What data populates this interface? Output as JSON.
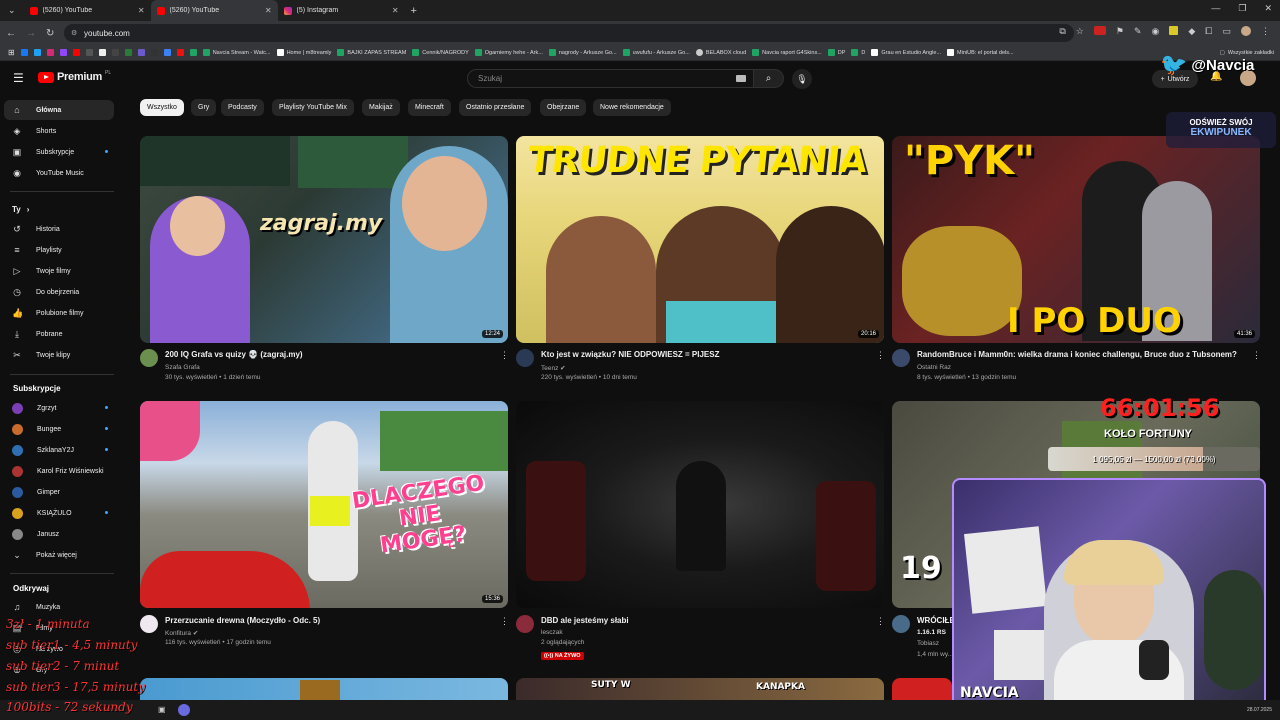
{
  "browser": {
    "tabs": [
      {
        "title": "(5260) YouTube",
        "active": false
      },
      {
        "title": "(5260) YouTube",
        "active": true
      },
      {
        "title": "(5) Instagram",
        "active": false
      }
    ],
    "url": "youtube.com",
    "bookmarks": [
      "Navcia Stream - Watc...",
      "Home | m8treamly",
      "BAJKI ZAPAS STREAM",
      "Cennik/NAGRODY",
      "Ogarniemy hehe - Ark...",
      "nagrody - Arkusze Go...",
      "uwufufu - Arkusze Go...",
      "BELABOX cloud",
      "Navcia raport G4Skins...",
      "DP",
      "D",
      "Grau en Estudio Angle...",
      "MiniUB: el portal dels...",
      "Wszystkie zakładki"
    ]
  },
  "header": {
    "logo": "Premium",
    "logo_country": "PL",
    "search_placeholder": "Szukaj",
    "create_label": "Utwórz"
  },
  "sidebar": {
    "main": [
      {
        "label": "Główna",
        "icon": "home-icon",
        "active": true
      },
      {
        "label": "Shorts",
        "icon": "shorts-icon"
      },
      {
        "label": "Subskrypcje",
        "icon": "subscriptions-icon",
        "dot": true
      },
      {
        "label": "YouTube Music",
        "icon": "music-icon"
      }
    ],
    "you_heading": "Ty",
    "you": [
      {
        "label": "Historia",
        "icon": "history-icon"
      },
      {
        "label": "Playlisty",
        "icon": "playlist-icon"
      },
      {
        "label": "Twoje filmy",
        "icon": "video-icon"
      },
      {
        "label": "Do obejrzenia",
        "icon": "clock-icon"
      },
      {
        "label": "Polubione filmy",
        "icon": "like-icon"
      },
      {
        "label": "Pobrane",
        "icon": "download-icon"
      },
      {
        "label": "Twoje klipy",
        "icon": "scissors-icon"
      }
    ],
    "subs_heading": "Subskrypcje",
    "subs": [
      {
        "label": "Zgrzyt",
        "color": "#7b3fb5",
        "dot": true
      },
      {
        "label": "Bungee",
        "color": "#c96b2c",
        "dot": true
      },
      {
        "label": "SzklanaY2J",
        "color": "#2f6fb1",
        "dot": true
      },
      {
        "label": "Karol Friz Wiśniewski",
        "color": "#a33",
        "dot": false
      },
      {
        "label": "Gimper",
        "color": "#2b5a9e",
        "dot": false
      },
      {
        "label": "KSIĄŻULO",
        "color": "#d8a21c",
        "dot": true
      },
      {
        "label": "Janusz",
        "color": "#888",
        "dot": false
      }
    ],
    "more_label": "Pokaż więcej",
    "explore_heading": "Odkrywaj",
    "explore": [
      {
        "label": "Muzyka",
        "icon": "music-note-icon"
      },
      {
        "label": "Filmy",
        "icon": "film-icon"
      },
      {
        "label": "Na żywo",
        "icon": "live-icon"
      },
      {
        "label": "Gry",
        "icon": "gamepad-icon"
      }
    ]
  },
  "chips": [
    "Wszystko",
    "Gry",
    "Podcasty",
    "Playlisty YouTube Mix",
    "Makijaż",
    "Minecraft",
    "Ostatnio przesłane",
    "Obejrzane",
    "Nowe rekomendacje"
  ],
  "videos": [
    {
      "title": "200 IQ Grafa vs quizy 💀 (zagraj.my)",
      "channel": "Szafa Grafa",
      "meta": "30 tys. wyświetleń • 1 dzień temu",
      "duration": "12:24",
      "thumb_text": "zagraj.my"
    },
    {
      "title": "Kto jest w związku? NIE ODPOWIESZ = PIJESZ",
      "channel": "Teenz",
      "meta": "220 tys. wyświetleń • 10 dni temu",
      "duration": "20:16",
      "thumb_text": "TRUDNE PYTANIA",
      "verified": true
    },
    {
      "title": "RandomBruce i Mamm0n: wielka drama i koniec challengu, Bruce duo z Tubsonem?",
      "channel": "Ostatni Raz",
      "meta": "8 tys. wyświetleń • 13 godzin temu",
      "duration": "41:36",
      "thumb_text": "\"PYK\"",
      "thumb_text2": "I PO DUO"
    },
    {
      "title": "Przerzucanie drewna (Moczydło - Odc. 5)",
      "channel": "Konfitura",
      "meta": "116 tys. wyświetleń • 17 godzin temu",
      "duration": "15:36",
      "thumb_text": "DLACZEGO NIE MOGĘ?",
      "verified": true
    },
    {
      "title": "DBD ale jesteśmy słabi",
      "channel": "lesczak",
      "meta": "2 oglądających",
      "live_label": "NA ŻYWO"
    },
    {
      "title": "WRÓCIŁE...",
      "channel": "Tobiasz",
      "meta": "1,4 mln wy...",
      "thumb_text": "1.16.1 RS"
    }
  ],
  "overlays": {
    "handle": "@Navcia",
    "refresh_line1": "ODŚWIEŻ SWÓJ",
    "refresh_line2": "EKWIPUNEK",
    "timer": "66:01:56",
    "wheel": "KOŁO FORTUNY",
    "wheel_amount": "1 095,05 zł — 1500,00 zł (73,00%)",
    "tiers": [
      "3zł - 1 minuta",
      "sub tier1 - 4,5 minuty",
      "sub tier2 - 7 minut",
      "sub tier3 - 17,5 minuty",
      "100bits - 72 sekundy"
    ],
    "cam_name": "NAVCIA"
  },
  "taskbar": {
    "date": "28.07.2025"
  }
}
